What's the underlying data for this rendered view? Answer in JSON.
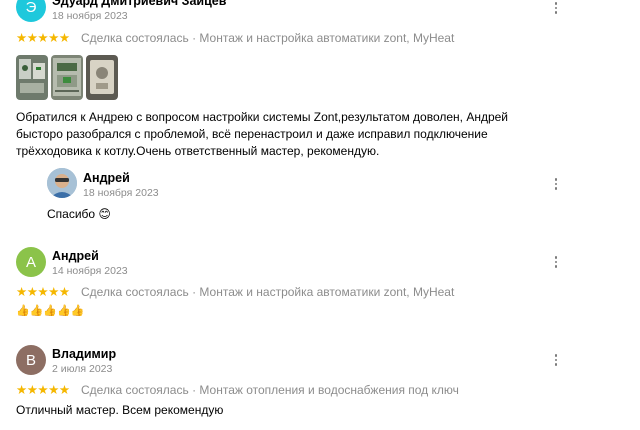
{
  "reviews": [
    {
      "name": "Эдуард Дмитриевич Зайцев",
      "initial": "Э",
      "avatar_color": "#1ec8dc",
      "date": "18 ноября 2023",
      "stars": "★★★★★",
      "deal": "Сделка состоялась · Монтаж и настройка автоматики zont, MyHeat",
      "text": "Обратился к Андрею с вопросом настройки системы Zont,результатом доволен, Андрей бысторо разобрался с проблемой, всё перенастроил и даже исправил подключение трёхходовика к котлу.Очень ответственный мастер, рекомендую.",
      "reply": {
        "name": "Андрей",
        "date": "18 ноября 2023",
        "text": "Спасибо 😊"
      }
    },
    {
      "name": "Андрей",
      "initial": "А",
      "avatar_color": "#8bc34a",
      "date": "14 ноября 2023",
      "stars": "★★★★★",
      "deal": "Сделка состоялась · Монтаж и настройка автоматики zont, MyHeat",
      "text": "👍👍👍👍👍"
    },
    {
      "name": "Владимир",
      "initial": "В",
      "avatar_color": "#8d6e63",
      "date": "2 июля 2023",
      "stars": "★★★★★",
      "deal": "Сделка состоялась · Монтаж отопления и водоснабжения под ключ",
      "text": "Отличный мастер. Всем рекомендую"
    }
  ],
  "colors": {
    "star": "#f5b700",
    "muted": "#8c8c8c"
  },
  "icons": {
    "menu": "more-vertical-icon"
  }
}
